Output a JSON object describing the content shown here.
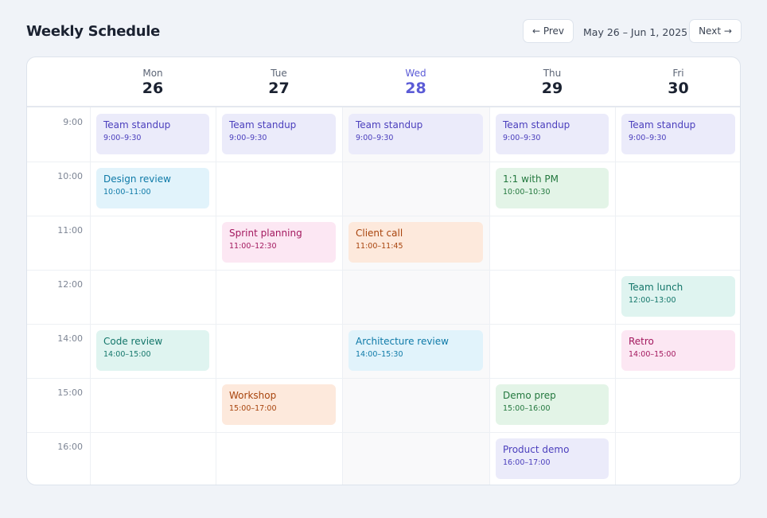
{
  "header": {
    "title": "Weekly Schedule",
    "prev_label": "← Prev",
    "next_label": "Next →",
    "date_range": "May 26 – Jun 1, 2025"
  },
  "colors": {
    "background": "#f0f3f8",
    "today_accent": "#5b5bd6",
    "purple_bg": "#ebebfa",
    "purple_fg": "#4b3fbd",
    "blue_bg": "#e1f3fb",
    "blue_fg": "#0e7aa8",
    "pink_bg": "#fce7f3",
    "pink_fg": "#a3185e",
    "orange_bg": "#fde9dc",
    "orange_fg": "#a8440d",
    "green_bg": "#e3f4e7",
    "green_fg": "#23783e",
    "teal_bg": "#dff4f0",
    "teal_fg": "#13766a"
  },
  "days": [
    {
      "name": "Mon",
      "num": "26",
      "today": false
    },
    {
      "name": "Tue",
      "num": "27",
      "today": false
    },
    {
      "name": "Wed",
      "num": "28",
      "today": true
    },
    {
      "name": "Thu",
      "num": "29",
      "today": false
    },
    {
      "name": "Fri",
      "num": "30",
      "today": false
    }
  ],
  "times": [
    "9:00",
    "10:00",
    "11:00",
    "12:00",
    "14:00",
    "15:00",
    "16:00"
  ],
  "events": [
    {
      "day": 0,
      "slot": 0,
      "title": "Team standup",
      "time": "9:00–9:30",
      "color": "purple"
    },
    {
      "day": 1,
      "slot": 0,
      "title": "Team standup",
      "time": "9:00–9:30",
      "color": "purple"
    },
    {
      "day": 2,
      "slot": 0,
      "title": "Team standup",
      "time": "9:00–9:30",
      "color": "purple"
    },
    {
      "day": 3,
      "slot": 0,
      "title": "Team standup",
      "time": "9:00–9:30",
      "color": "purple"
    },
    {
      "day": 4,
      "slot": 0,
      "title": "Team standup",
      "time": "9:00–9:30",
      "color": "purple"
    },
    {
      "day": 0,
      "slot": 1,
      "title": "Design review",
      "time": "10:00–11:00",
      "color": "blue"
    },
    {
      "day": 3,
      "slot": 1,
      "title": "1:1 with PM",
      "time": "10:00–10:30",
      "color": "green"
    },
    {
      "day": 1,
      "slot": 2,
      "title": "Sprint planning",
      "time": "11:00–12:30",
      "color": "pink"
    },
    {
      "day": 2,
      "slot": 2,
      "title": "Client call",
      "time": "11:00–11:45",
      "color": "orange"
    },
    {
      "day": 4,
      "slot": 3,
      "title": "Team lunch",
      "time": "12:00–13:00",
      "color": "teal"
    },
    {
      "day": 0,
      "slot": 4,
      "title": "Code review",
      "time": "14:00–15:00",
      "color": "teal"
    },
    {
      "day": 2,
      "slot": 4,
      "title": "Architecture review",
      "time": "14:00–15:30",
      "color": "blue"
    },
    {
      "day": 4,
      "slot": 4,
      "title": "Retro",
      "time": "14:00–15:00",
      "color": "pink"
    },
    {
      "day": 1,
      "slot": 5,
      "title": "Workshop",
      "time": "15:00–17:00",
      "color": "orange"
    },
    {
      "day": 3,
      "slot": 5,
      "title": "Demo prep",
      "time": "15:00–16:00",
      "color": "green"
    },
    {
      "day": 3,
      "slot": 6,
      "title": "Product demo",
      "time": "16:00–17:00",
      "color": "purple"
    }
  ]
}
